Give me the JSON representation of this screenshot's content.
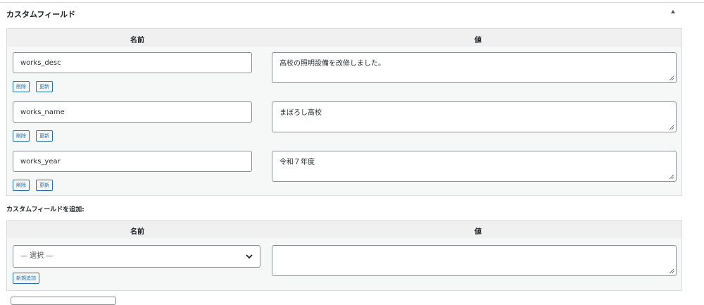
{
  "panel": {
    "title": "カスタムフィールド"
  },
  "table": {
    "col_name": "名前",
    "col_value": "値",
    "rows": [
      {
        "key": "works_desc",
        "value": "高校の照明設備を改修しました。",
        "delete_label": "削除",
        "update_label": "更新"
      },
      {
        "key": "works_name",
        "value": "まぼろし高校",
        "delete_label": "削除",
        "update_label": "更新"
      },
      {
        "key": "works_year",
        "value": "令和７年度",
        "delete_label": "削除",
        "update_label": "更新"
      }
    ]
  },
  "add": {
    "title": "カスタムフィールドを追加:",
    "col_name": "名前",
    "col_value": "値",
    "select_value": "— 選択 —",
    "value": "",
    "add_button": "新規追加"
  },
  "colors": {
    "accent": "#2271b1",
    "border": "#8c8f94",
    "header_bg": "#f0f0f1"
  },
  "icons": [
    "triangle-up-icon",
    "chevron-down-icon",
    "resize-grip-icon"
  ]
}
